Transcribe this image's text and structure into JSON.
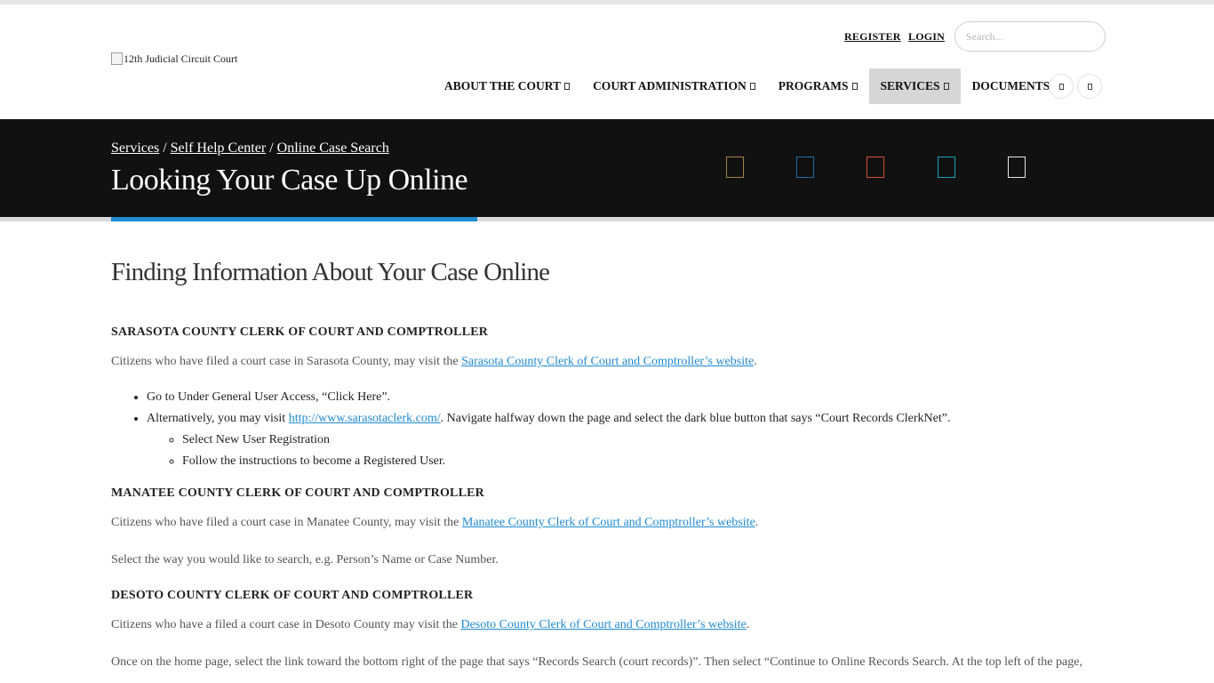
{
  "header": {
    "logo_alt": "12th Judicial Circuit Court",
    "register": "REGISTER",
    "login": "LOGIN",
    "search_placeholder": "Search..."
  },
  "nav": {
    "items": [
      {
        "label": "ABOUT THE COURT",
        "active": false
      },
      {
        "label": "COURT ADMINISTRATION",
        "active": false
      },
      {
        "label": "PROGRAMS",
        "active": false
      },
      {
        "label": "SERVICES",
        "active": true
      },
      {
        "label": "DOCUMENTS",
        "active": false
      }
    ]
  },
  "banner": {
    "breadcrumb": [
      "Services",
      "Self Help Center",
      "Online Case Search"
    ],
    "breadcrumb_separator": "/",
    "title": "Looking Your Case Up Online",
    "social_colors": [
      "#a5804a",
      "#1c6fa5",
      "#d2503a",
      "#1ba0bf",
      "#e6e6e6"
    ]
  },
  "main": {
    "heading": "Finding Information About Your Case Online",
    "sarasota": {
      "title": "SARASOTA COUNTY CLERK OF COURT AND COMPTROLLER",
      "intro": "Citizens who have filed a court case in Sarasota County, may visit the",
      "link": "Sarasota County Clerk of Court and Comptroller’s website",
      "period": ".",
      "bullet1": "Go to Under General User Access, “Click Here”.",
      "bullet2_pre": "Alternatively, you may visit",
      "bullet2_link": "http://www.sarasotaclerk.com/",
      "bullet2_post": ". Navigate halfway down the page and select the dark blue button that says “Court Records ClerkNet”.",
      "sub1": "Select New User Registration",
      "sub2": "Follow the instructions to become a Registered User."
    },
    "manatee": {
      "title": "MANATEE COUNTY CLERK OF COURT AND COMPTROLLER",
      "intro": "Citizens who have filed a court case in Manatee County, may visit the",
      "link": "Manatee County Clerk of Court and Comptroller’s website",
      "period": ".",
      "note": "Select the way you would like to search, e.g. Person’s Name or Case Number."
    },
    "desoto": {
      "title": "DESOTO COUNTY CLERK OF COURT AND COMPTROLLER",
      "intro": "Citizens who have a filed a court case in Desoto County may visit the",
      "link": "Desoto County Clerk of Court and Comptroller’s website",
      "period": ".",
      "note": "Once on the home page, select the link toward the bottom right of the page that says “Records Search (court records)”.  Then select “Continue to Online Records Search. At the top left of the page,"
    }
  }
}
